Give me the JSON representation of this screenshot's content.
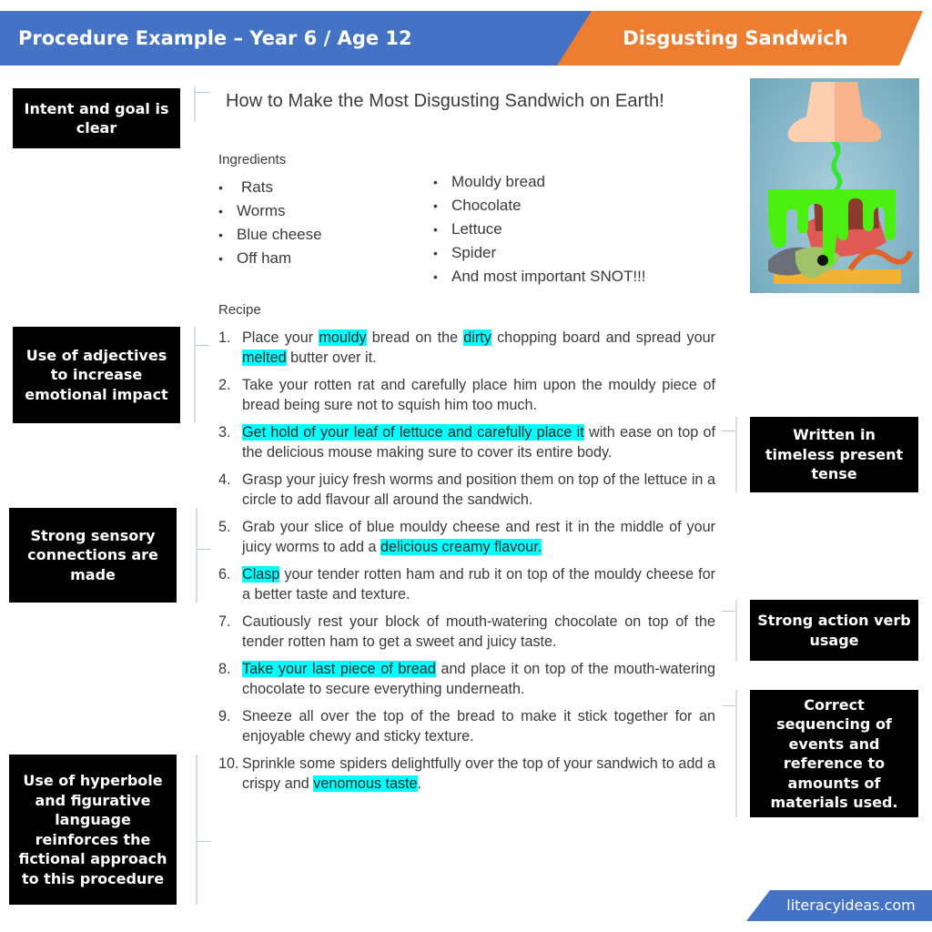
{
  "header": {
    "left_title": "Procedure Example – Year 6 / Age 12",
    "right_title": "Disgusting Sandwich",
    "left_color": "#4472c4",
    "right_color": "#ed7d31"
  },
  "document": {
    "title": "How to Make the Most Disgusting Sandwich on Earth!",
    "ingredients_label": "Ingredients",
    "ingredients_col1": [
      "Rats",
      "Worms",
      "Blue cheese",
      "Off ham"
    ],
    "ingredients_col2": [
      "Mouldy bread",
      "Chocolate",
      "Lettuce",
      "Spider",
      "And most important SNOT!!!"
    ],
    "recipe_label": "Recipe",
    "highlight_color": "#00ffff",
    "steps": [
      {
        "num": "1.",
        "parts": [
          {
            "t": "Place your "
          },
          {
            "t": "mouldy",
            "hl": true
          },
          {
            "t": " bread on the "
          },
          {
            "t": "dirty",
            "hl": true
          },
          {
            "t": " chopping board and spread your "
          },
          {
            "t": "melted",
            "hl": true
          },
          {
            "t": " butter over it."
          }
        ]
      },
      {
        "num": "2.",
        "parts": [
          {
            "t": "Take your rotten rat and carefully place him upon the mouldy piece of bread being sure not to squish him too much."
          }
        ]
      },
      {
        "num": "3.",
        "parts": [
          {
            "t": "Get hold of your leaf of lettuce and carefully place it",
            "hl": true
          },
          {
            "t": " with ease on top of the delicious mouse making sure to cover its entire body."
          }
        ]
      },
      {
        "num": "4.",
        "parts": [
          {
            "t": "Grasp your juicy fresh worms and position them on top of the lettuce in a circle to add flavour all around the sandwich."
          }
        ]
      },
      {
        "num": "5.",
        "parts": [
          {
            "t": "Grab your slice of blue mouldy cheese and rest it in the middle of your juicy worms to add a "
          },
          {
            "t": "delicious creamy flavour.",
            "hl": true
          }
        ]
      },
      {
        "num": "6.",
        "parts": [
          {
            "t": "Clasp",
            "hl": true
          },
          {
            "t": " your tender rotten ham and rub it on top of the mouldy cheese for a better taste and texture."
          }
        ]
      },
      {
        "num": "7.",
        "parts": [
          {
            "t": "Cautiously rest your block of mouth-watering chocolate on top of the tender rotten ham to get a sweet and juicy taste."
          }
        ]
      },
      {
        "num": "8.",
        "parts": [
          {
            "t": "Take your last piece of bread",
            "hl": true
          },
          {
            "t": " and place it on top of the mouth-watering chocolate to secure everything underneath."
          }
        ]
      },
      {
        "num": "9.",
        "parts": [
          {
            "t": "Sneeze all over the top of the bread to make it stick together for an enjoyable chewy and sticky texture."
          }
        ]
      },
      {
        "num": "10.",
        "parts": [
          {
            "t": "Sprinkle some spiders delightfully over the top of your sandwich to add a crispy and "
          },
          {
            "t": "venomous taste",
            "hl": true
          },
          {
            "t": "."
          }
        ]
      }
    ]
  },
  "annotations": {
    "intent": "Intent and goal is clear",
    "adjectives": "Use of adjectives to increase emotional impact",
    "sensory": "Strong sensory connections are made",
    "hyperbole": "Use of hyperbole and figurative language reinforces the fictional approach to this procedure",
    "tense": "Written in timeless present tense",
    "action_verb": "Strong action verb usage",
    "sequencing": "Correct sequencing of events and reference to amounts of materials used."
  },
  "illustration": {
    "icon": "disgusting-sandwich-illustration"
  },
  "footer": {
    "site": "literacyideas.com"
  }
}
